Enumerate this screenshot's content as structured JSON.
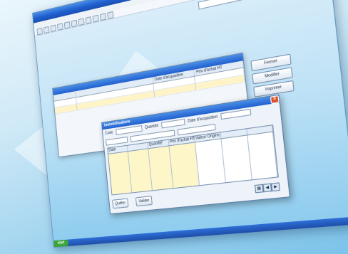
{
  "app": {
    "title": "",
    "menu": [],
    "period_field": "",
    "taskbar_start": "start"
  },
  "record_list": {
    "title": "",
    "columns": [
      "",
      "",
      "Date d'acquisition",
      "Prix d'achat HT"
    ],
    "rows": [
      [
        "",
        "",
        "",
        ""
      ],
      [
        "",
        "",
        "",
        ""
      ]
    ],
    "buttons": {
      "fermer": "Fermer",
      "modifier": "Modifier",
      "imprimer": "Imprimer"
    }
  },
  "dialog": {
    "title": "Immobilisations",
    "fields": {
      "code_label": "Code",
      "quantity_label": "Quantité",
      "acq_date_label": "Date d'acquisition"
    },
    "table": {
      "headers": [
        "Date",
        "",
        "Quantité",
        "Prix d'achat HT",
        "Valeur Origine",
        "",
        ""
      ],
      "rows": [
        [
          "",
          "",
          "",
          "",
          "",
          "",
          ""
        ]
      ]
    },
    "buttons": {
      "quitter": "Quitter",
      "valider": "Valider"
    }
  },
  "colors": {
    "title_blue": "#1f5fcf",
    "highlight_yellow": "#fdf6c8",
    "close_red": "#d9532c"
  }
}
